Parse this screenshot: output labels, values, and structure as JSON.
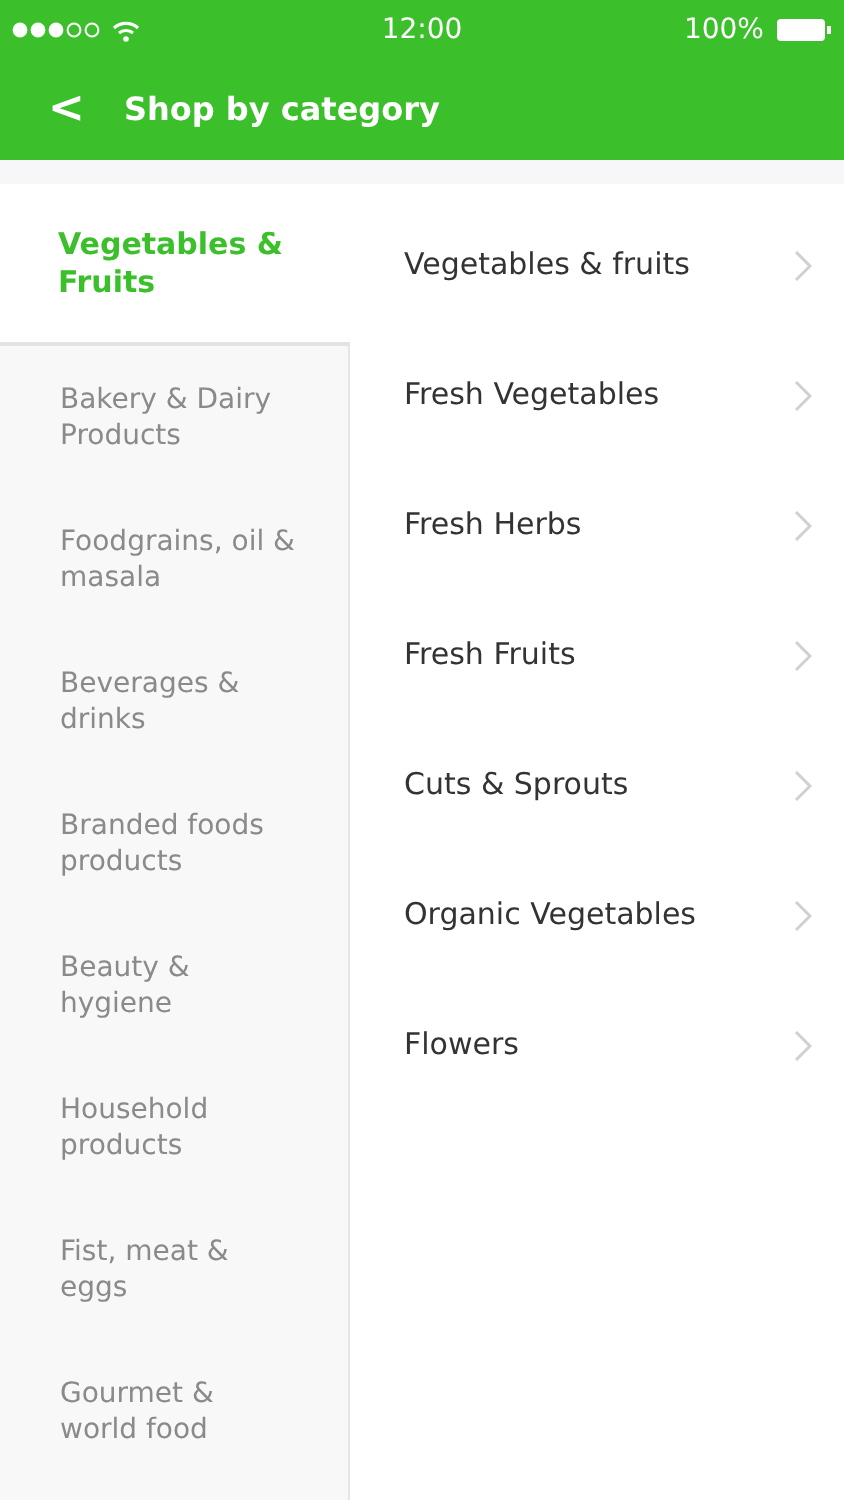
{
  "status_bar": {
    "time": "12:00",
    "battery": "100%"
  },
  "header": {
    "back": "<",
    "title": "Shop by category"
  },
  "categories": [
    {
      "label": "Vegetables & Fruits",
      "selected": true
    },
    {
      "label": "Bakery & Dairy Products",
      "selected": false
    },
    {
      "label": "Foodgrains, oil & masala",
      "selected": false
    },
    {
      "label": "Beverages & drinks",
      "selected": false
    },
    {
      "label": "Branded foods products",
      "selected": false
    },
    {
      "label": "Beauty & hygiene",
      "selected": false
    },
    {
      "label": "Household products",
      "selected": false
    },
    {
      "label": "Fist, meat & eggs",
      "selected": false
    },
    {
      "label": "Gourmet & world food",
      "selected": false
    }
  ],
  "subcategories": [
    "Vegetables & fruits",
    "Fresh Vegetables",
    "Fresh Herbs",
    "Fresh Fruits",
    "Cuts & Sprouts",
    "Organic Vegetables",
    "Flowers"
  ]
}
